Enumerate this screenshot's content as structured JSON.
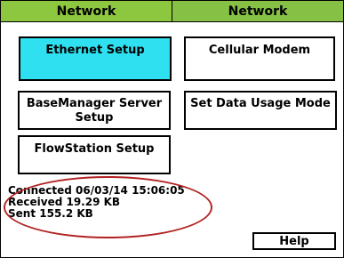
{
  "tabs": [
    {
      "label": "Network",
      "active": true
    },
    {
      "label": "Network",
      "active": false
    }
  ],
  "buttons": {
    "ethernet_setup": "Ethernet Setup",
    "cellular_modem": "Cellular Modem",
    "basemanager_server_setup_line1": "BaseManager Server",
    "basemanager_server_setup_line2": "Setup",
    "set_data_usage_mode": "Set Data Usage Mode",
    "flowstation_setup": "FlowStation Setup",
    "help": "Help"
  },
  "status": {
    "connected": "Connected 06/03/14 15:06:05",
    "received": "Received 19.29 KB",
    "sent": "Sent 155.2 KB"
  },
  "colors": {
    "tab_bg": "#8dc63f",
    "active_button_bg": "#2fe0f0",
    "annotation_outline": "#b22222"
  }
}
